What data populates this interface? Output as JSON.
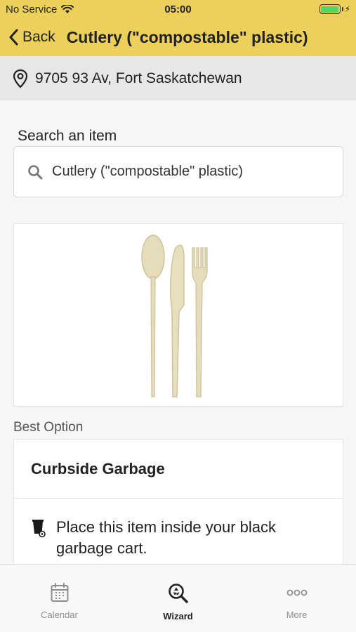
{
  "status_bar": {
    "carrier": "No Service",
    "time": "05:00"
  },
  "nav": {
    "back_label": "Back",
    "title": "Cutlery (\"compostable\" plastic)"
  },
  "location": {
    "address": "9705 93 Av, Fort Saskatchewan"
  },
  "search": {
    "label": "Search an item",
    "value": "Cutlery (\"compostable\" plastic)"
  },
  "item_image": {
    "alt": "Cutlery image"
  },
  "best_option": {
    "label": "Best Option",
    "title": "Curbside Garbage",
    "description": "Place this item inside your black garbage cart."
  },
  "tabs": [
    {
      "label": "Calendar",
      "icon": "calendar-icon",
      "active": false
    },
    {
      "label": "Wizard",
      "icon": "wizard-search-icon",
      "active": true
    },
    {
      "label": "More",
      "icon": "more-icon",
      "active": false
    }
  ],
  "colors": {
    "header": "#edd05a",
    "battery": "#4cd964"
  }
}
